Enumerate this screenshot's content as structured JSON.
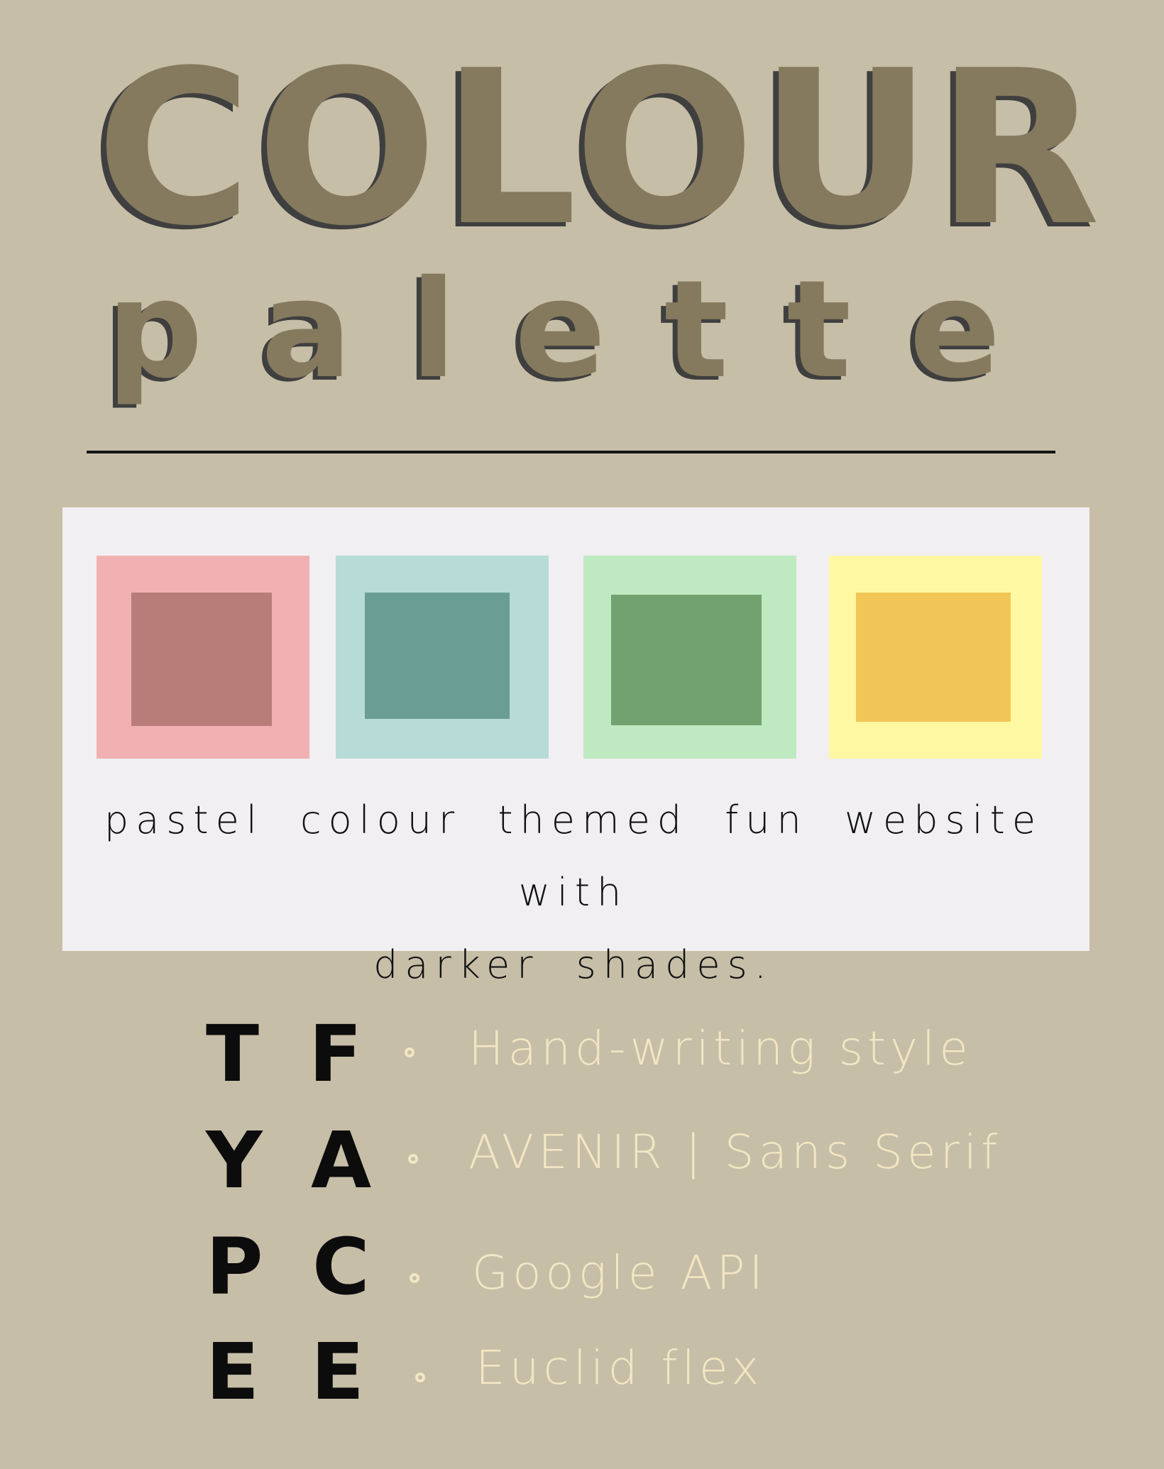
{
  "title": {
    "line1": "COLOUR",
    "line2_letters": [
      "p",
      "a",
      "l",
      "e",
      "t",
      "t",
      "e"
    ]
  },
  "colors": {
    "background": "#c6bea7",
    "title": "#857a5e",
    "title_shadow": "#3f3f3f",
    "card": "#f1eff2",
    "typeface_text": "#f3e6c3"
  },
  "palette": {
    "swatches": [
      {
        "name": "pink",
        "outer": "#f1b1b2",
        "inner": "#b87d79"
      },
      {
        "name": "teal",
        "outer": "#b7dbd7",
        "inner": "#6a9e94"
      },
      {
        "name": "green",
        "outer": "#bfe9c0",
        "inner": "#71a270"
      },
      {
        "name": "yellow",
        "outer": "#fff8a2",
        "inner": "#f2c656"
      }
    ],
    "caption_line1": "pastel colour themed fun website with",
    "caption_line2": "darker shades."
  },
  "typeface": {
    "rows": [
      {
        "left": "T",
        "right": "F",
        "text": "Hand-writing style"
      },
      {
        "left": "Y",
        "right": "A",
        "text": "AVENIR | Sans Serif"
      },
      {
        "left": "P",
        "right": "C",
        "text": "Google API"
      },
      {
        "left": "E",
        "right": "E",
        "text": "Euclid flex"
      }
    ]
  }
}
